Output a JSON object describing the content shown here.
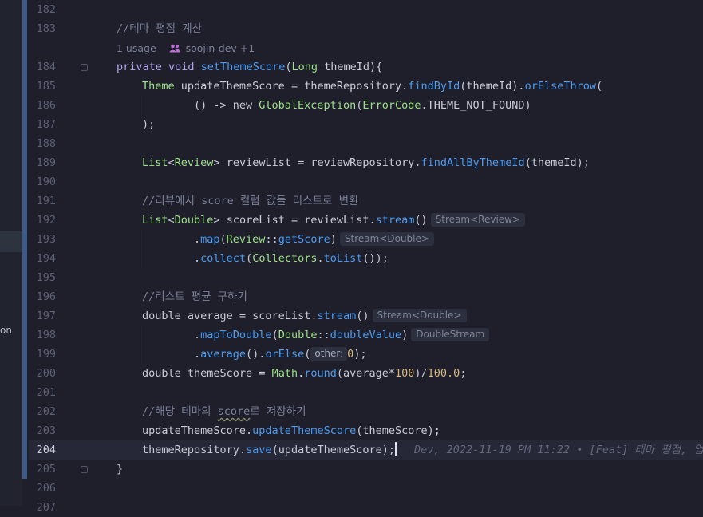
{
  "sidebar": {
    "fragment": "on"
  },
  "colors": {
    "keyword": "#b5a6ee",
    "function": "#4d9cf0",
    "class": "#9fe08a",
    "comment": "#7c8199",
    "number": "#d7b981",
    "text": "#c9ccd6"
  },
  "editor": {
    "line_numbers": [
      "182",
      "183",
      "",
      "184",
      "185",
      "186",
      "187",
      "188",
      "189",
      "190",
      "191",
      "192",
      "193",
      "194",
      "195",
      "196",
      "197",
      "198",
      "199",
      "200",
      "201",
      "202",
      "203",
      "204",
      "205",
      "206",
      "207"
    ],
    "current_line": "204",
    "usage_hint": {
      "count": "1 usage",
      "author": "soojin-dev +1",
      "icon": "users-icon"
    },
    "code": {
      "l183": "//테마 평점 계산",
      "l184_a": "private void ",
      "l184_fn": "setThemeScore",
      "l184_b": "(",
      "l184_cls": "Long",
      "l184_c": " themeId){",
      "l185_cls": "Theme",
      "l185_a": " updateThemeScore = themeRepository.",
      "l185_fn1": "findById",
      "l185_b": "(themeId).",
      "l185_fn2": "orElseThrow",
      "l185_c": "(",
      "l186_a": "() -> new ",
      "l186_cls1": "GlobalException",
      "l186_b": "(",
      "l186_cls2": "ErrorCode",
      "l186_c": ".THEME_NOT_FOUND)",
      "l187": ");",
      "l189_cls1": "List",
      "l189_a": "<",
      "l189_cls2": "Review",
      "l189_b": "> reviewList = reviewRepository.",
      "l189_fn": "findAllByThemeId",
      "l189_c": "(themeId);",
      "l191": "//리뷰에서 score 컬럼 값들 리스트로 변환",
      "l192_cls1": "List",
      "l192_a": "<",
      "l192_cls2": "Double",
      "l192_b": "> scoreList = reviewList.",
      "l192_fn": "stream",
      "l192_c": "()",
      "l192_hint": "Stream<Review>",
      "l193_a": ".",
      "l193_fn1": "map",
      "l193_b": "(",
      "l193_cls": "Review",
      "l193_c": "::",
      "l193_fn2": "getScore",
      "l193_d": ")",
      "l193_hint": "Stream<Double>",
      "l194_a": ".",
      "l194_fn1": "collect",
      "l194_b": "(",
      "l194_cls": "Collectors",
      "l194_c": ".",
      "l194_fn2": "toList",
      "l194_d": "());",
      "l196": "//리스트 평균 구하기",
      "l197_a": "double average = scoreList.",
      "l197_fn": "stream",
      "l197_b": "()",
      "l197_hint": "Stream<Double>",
      "l198_a": ".",
      "l198_fn1": "mapToDouble",
      "l198_b": "(",
      "l198_cls": "Double",
      "l198_c": "::",
      "l198_fn2": "doubleValue",
      "l198_d": ")",
      "l198_hint": "DoubleStream",
      "l199_a": ".",
      "l199_fn1": "average",
      "l199_b": "().",
      "l199_fn2": "orElse",
      "l199_c": "(",
      "l199_param": "other:",
      "l199_num": "0",
      "l199_d": ");",
      "l200_a": "double themeScore = ",
      "l200_cls": "Math",
      "l200_b": ".",
      "l200_fn": "round",
      "l200_c": "(average*",
      "l200_num1": "100",
      "l200_d": ")/",
      "l200_num2": "100.0",
      "l200_e": ";",
      "l202_a": "//해당 테마의 ",
      "l202_squig": "score",
      "l202_b": "로 저장하기",
      "l203_a": "updateThemeScore.",
      "l203_fn": "updateThemeScore",
      "l203_b": "(themeScore);",
      "l204_a": "themeRepository.",
      "l204_fn": "save",
      "l204_b": "(updateThemeScore);",
      "l204_blame": "Dev, 2022-11-19 PM 11:22 • [Feat] 테마 평점, 업",
      "l205": "}"
    }
  }
}
